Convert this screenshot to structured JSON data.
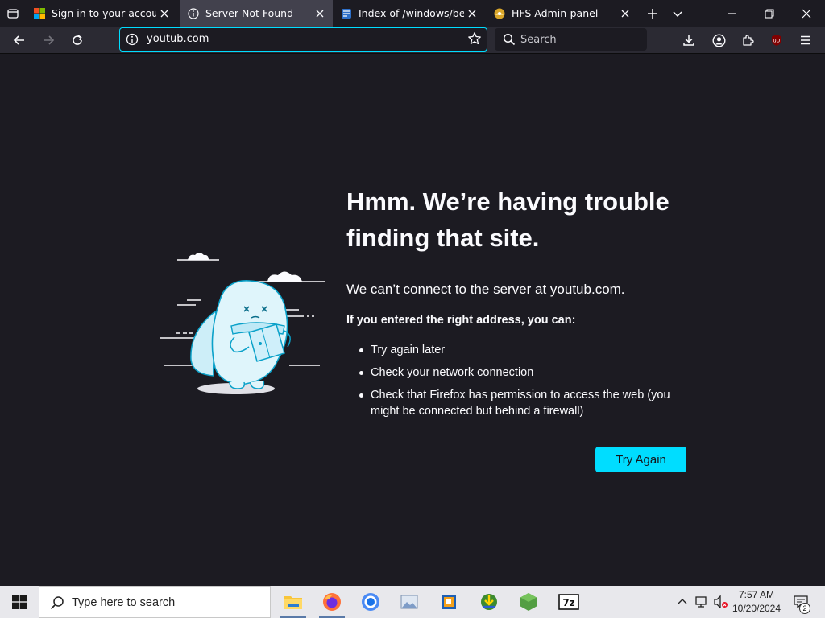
{
  "browser": {
    "tabs": [
      {
        "title": "Sign in to your account",
        "favicon": "microsoft-logo",
        "active": false
      },
      {
        "title": "Server Not Found",
        "favicon": "info-icon",
        "active": true
      },
      {
        "title": "Index of /windows/beta/",
        "favicon": "document-icon",
        "active": false
      },
      {
        "title": "HFS Admin-panel",
        "favicon": "hfs-logo",
        "active": false
      }
    ],
    "url": "youtub.com",
    "search_placeholder": "Search",
    "accent_color": "#00ddff"
  },
  "error_page": {
    "title": "Hmm. We’re having trouble finding that site.",
    "description": "We can’t connect to the server at youtub.com.",
    "subtitle": "If you entered the right address, you can:",
    "suggestions": [
      "Try again later",
      "Check your network connection",
      "Check that Firefox has permission to access the web (you might be connected but behind a firewall)"
    ],
    "try_again_label": "Try Again"
  },
  "taskbar": {
    "search_placeholder": "Type here to search",
    "apps": [
      "file-explorer",
      "firefox",
      "chrome",
      "image-viewer",
      "virtualbox",
      "download-manager",
      "node-js",
      "7zip"
    ],
    "clock": {
      "time": "7:57 AM",
      "date": "10/20/2024"
    },
    "notification_count": "2"
  }
}
